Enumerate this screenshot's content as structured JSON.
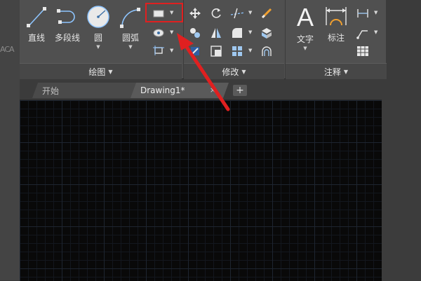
{
  "left_strip_text": "ACA",
  "ribbon": {
    "draw_panel": {
      "title": "绘图",
      "line_label": "直线",
      "polyline_label": "多段线",
      "circle_label": "圆",
      "arc_label": "圆弧"
    },
    "modify_panel": {
      "title": "修改"
    },
    "annotation_panel": {
      "title": "注释",
      "text_label": "文字",
      "dimension_label": "标注",
      "text_glyph": "A"
    }
  },
  "tabs": {
    "start_label": "开始",
    "drawing_label": "Drawing1*",
    "close_glyph": "×",
    "add_glyph": "+"
  },
  "colors": {
    "highlight_box": "#e02020",
    "arrow": "#e02020",
    "canvas_bg": "#090909"
  }
}
